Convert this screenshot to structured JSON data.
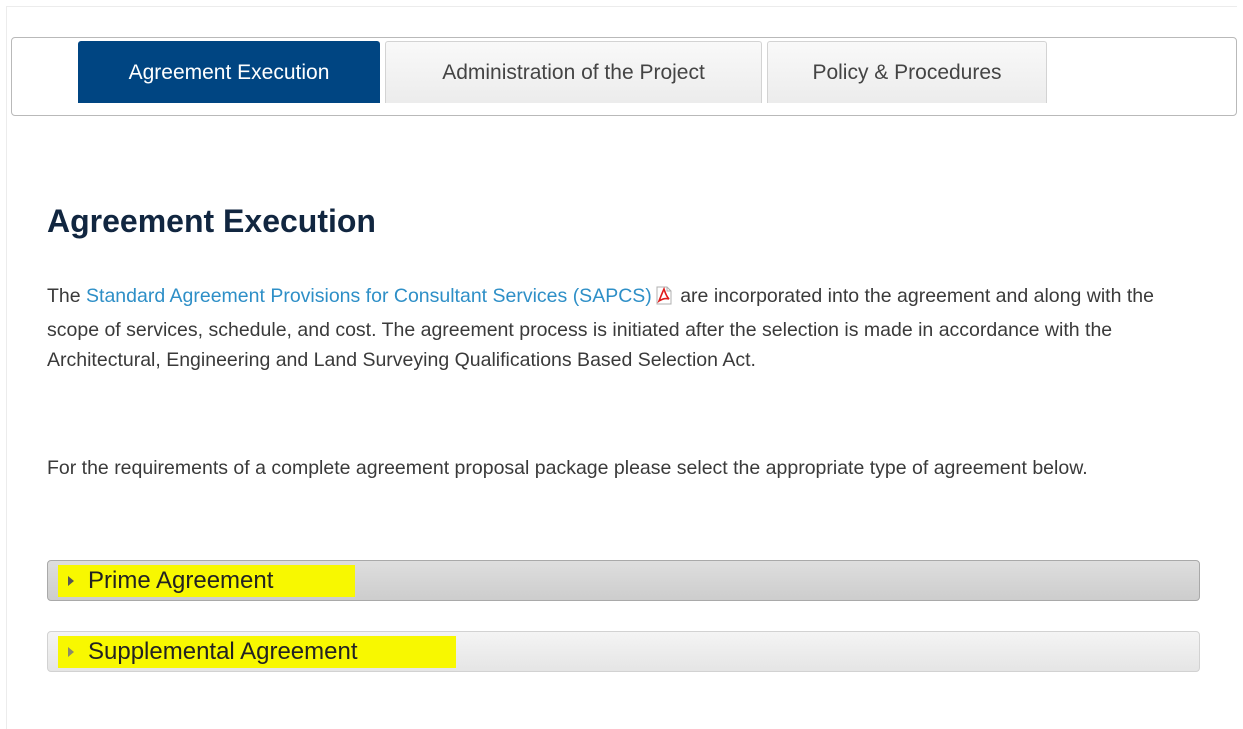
{
  "tabs": [
    {
      "label": "Agreement Execution",
      "active": true
    },
    {
      "label": "Administration of the Project",
      "active": false
    },
    {
      "label": "Policy & Procedures",
      "active": false
    }
  ],
  "section": {
    "title": "Agreement Execution",
    "para1": {
      "prefix": "The ",
      "link_text": "Standard Agreement Provisions for Consultant Services (SAPCS)",
      "link_icon": "pdf-icon",
      "suffix": " are incorporated into the agreement and along with the scope of services, schedule, and cost. The agreement process is initiated after the selection is made in accordance with the Architectural, Engineering and Land Surveying Qualifications Based Selection Act."
    },
    "para2": "For the requirements of a complete agreement proposal package please select the appropriate type of agreement below."
  },
  "accordion": [
    {
      "label": "Prime Agreement",
      "icon": "caret-right-icon",
      "highlighted": true
    },
    {
      "label": "Supplemental Agreement",
      "icon": "caret-right-icon",
      "highlighted": true
    }
  ],
  "colors": {
    "active_tab": "#004582",
    "link": "#2e8fc7",
    "title": "#112640",
    "highlight": "#f8f800"
  }
}
